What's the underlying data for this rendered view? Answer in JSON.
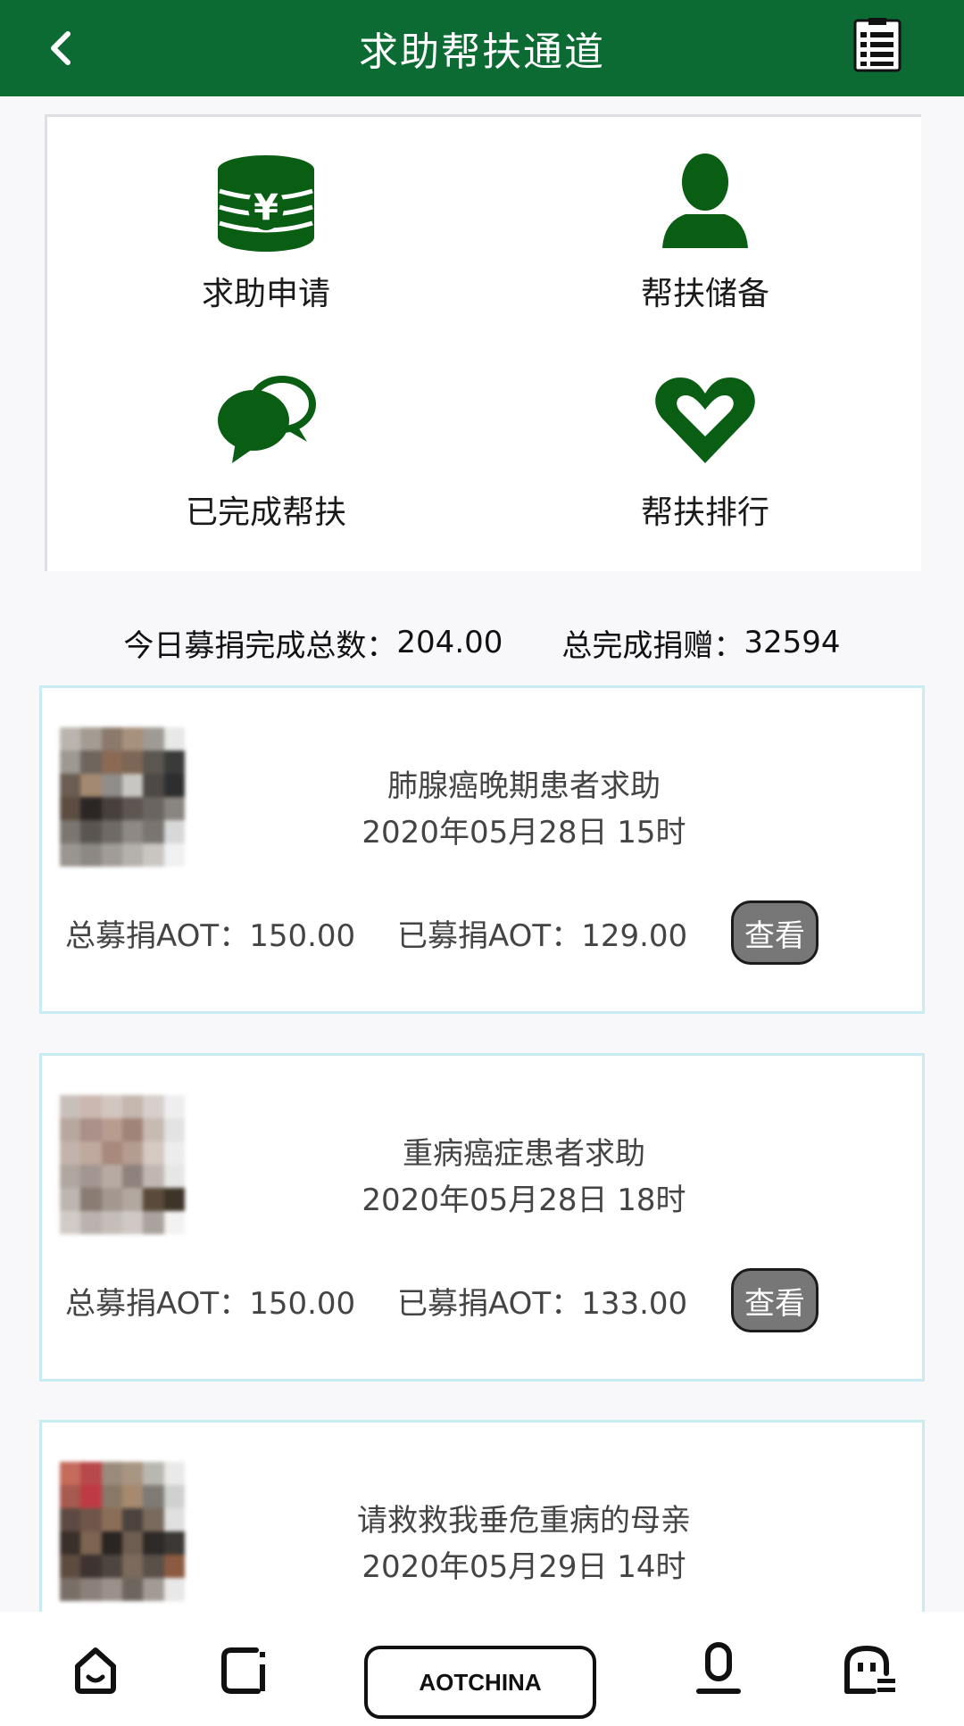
{
  "header": {
    "title": "求助帮扶通道"
  },
  "menu": {
    "items": [
      {
        "label": "求助申请",
        "icon": "coin-stack-yen-icon"
      },
      {
        "label": "帮扶储备",
        "icon": "person-icon"
      },
      {
        "label": "已完成帮扶",
        "icon": "chat-bubbles-icon"
      },
      {
        "label": "帮扶排行",
        "icon": "heart-icon"
      }
    ]
  },
  "stats": {
    "today_label": "今日募捐完成总数：",
    "today_value": "204.00",
    "total_label": "总完成捐赠：",
    "total_value": "32594"
  },
  "cases": [
    {
      "title": "肺腺癌晚期患者求助",
      "date": "2020年05月28日 15时",
      "total": "总募捐AOT：150.00",
      "raised": "已募捐AOT：129.00",
      "button": "查看"
    },
    {
      "title": "重病癌症患者求助",
      "date": "2020年05月28日 18时",
      "total": "总募捐AOT：150.00",
      "raised": "已募捐AOT：133.00",
      "button": "查看"
    },
    {
      "title": "请救救我垂危重病的母亲",
      "date": "2020年05月29日 14时"
    }
  ],
  "bottom_nav": {
    "brand": "AOTCHINA",
    "icons": [
      "home-icon",
      "square-info-icon",
      "microphone-icon",
      "face-menu-icon"
    ]
  },
  "colors": {
    "primary_green": "#0c6a33",
    "icon_green": "#0a5e14",
    "card_border": "#c8ecef",
    "button_gray": "#777777"
  }
}
